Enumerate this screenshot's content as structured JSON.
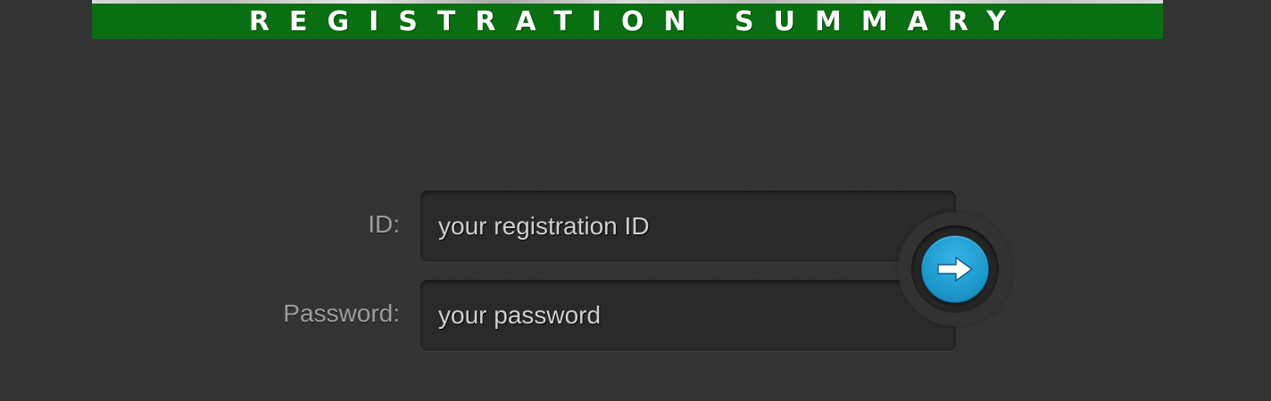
{
  "banner": {
    "title": "REGISTRATION SUMMARY",
    "bar_color": "#0a6e12"
  },
  "form": {
    "id_label": "ID:",
    "id_placeholder": "your registration ID",
    "password_label": "Password:",
    "password_placeholder": "your password",
    "submit_icon": "arrow-right-icon",
    "accent_color": "#1e9ccf"
  }
}
